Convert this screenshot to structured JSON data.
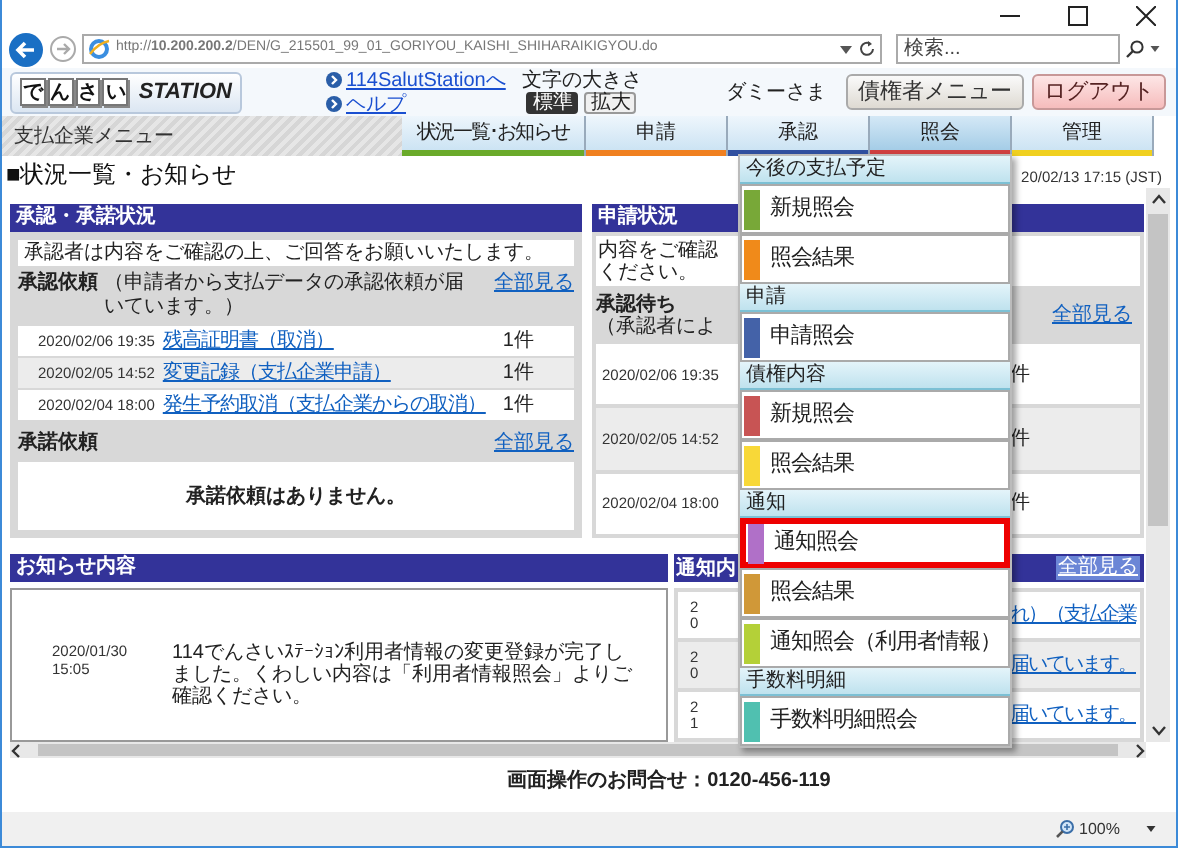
{
  "address_bar": {
    "url": "http://**10.200.200.2**/DEN/G_215501_99_01_GORIYOU_KAISHI_SHIHARAIKIGYOU.do"
  },
  "search": {
    "placeholder": "検索..."
  },
  "header": {
    "logo": {
      "chars": [
        "で",
        "ん",
        "さ",
        "い"
      ],
      "text": "STATION"
    },
    "links": [
      "114SalutStationへ",
      "ヘルプ"
    ],
    "font_size": {
      "label": "文字の大きさ",
      "options": [
        {
          "label": "標準",
          "selected": true
        },
        {
          "label": "拡大",
          "selected": false
        }
      ]
    },
    "user": "ダミーさま",
    "buttons": [
      {
        "label": "債権者メニュー",
        "kind": "default"
      },
      {
        "label": "ログアウト",
        "kind": "danger"
      }
    ]
  },
  "nav": {
    "label": "支払企業メニュー",
    "tabs": [
      {
        "label": "状況一覧･お知らせ",
        "selected": false,
        "color": "#6aaa2a"
      },
      {
        "label": "申請",
        "selected": false,
        "color": "#f08020"
      },
      {
        "label": "承認",
        "selected": false,
        "color": "#3050a0"
      },
      {
        "label": "照会",
        "selected": true,
        "color": "#d04040"
      },
      {
        "label": "管理",
        "selected": false,
        "color": "#f0d020"
      }
    ]
  },
  "page": {
    "title": "■状況一覧・お知らせ",
    "timestamp": "20/02/13 17:15 (JST)"
  },
  "approval_panel": {
    "title": "承認・承諾状況",
    "intro": "承認者は内容をご確認の上、ご回答をお願いいたします。",
    "request_section": {
      "title": "承認依頼",
      "note": "（申請者から支払データの承認依頼が届いています。）",
      "more": "全部見る",
      "rows": [
        {
          "date": "2020/02/06 19:35",
          "link": "残高証明書（取消）",
          "count": "1件"
        },
        {
          "date": "2020/02/05 14:52",
          "link": "変更記録（支払企業申請）",
          "count": "1件"
        },
        {
          "date": "2020/02/04 18:00",
          "link": "発生予約取消（支払企業からの取消）",
          "count": "1件"
        }
      ]
    },
    "consent_section": {
      "title": "承諾依頼",
      "more": "全部見る",
      "empty": "承諾依頼はありません。"
    }
  },
  "application_panel": {
    "title": "申請状況",
    "intro": "内容をご確認ください。",
    "section_title": "承認待ち",
    "note": "（承認者によ",
    "more": "全部見る",
    "rows": [
      {
        "date": "2020/02/06 19:35",
        "count": "件"
      },
      {
        "date": "2020/02/05 14:52",
        "count": "件"
      },
      {
        "date": "2020/02/04 18:00",
        "count": "件"
      }
    ]
  },
  "notice_panel": {
    "title": "お知らせ内容",
    "rows": [
      {
        "date": "2020/01/30",
        "time": "15:05",
        "text": "114でんさいｽﾃｰｼｮﾝ利用者情報の変更登録が完了しました。くわしい内容は「利用者情報照会」よりご確認ください。"
      }
    ]
  },
  "notification_panel": {
    "title": "通知内",
    "more": "全部見る",
    "rows": [
      {
        "date_fragment": [
          "2",
          "0"
        ],
        "text": "れ）（支払企業"
      },
      {
        "date_fragment": [
          "2",
          "0"
        ],
        "text": "届いています。"
      },
      {
        "date_fragment": [
          "2",
          "1"
        ],
        "text": "届いています。"
      }
    ]
  },
  "menu": {
    "sections": [
      {
        "title": "今後の支払予定",
        "items": [
          {
            "label": "新規照会",
            "color": "#78a838",
            "selected": false
          },
          {
            "label": "照会結果",
            "color": "#f08a1a",
            "selected": false
          }
        ]
      },
      {
        "title": "申請",
        "items": [
          {
            "label": "申請照会",
            "color": "#4462a8",
            "selected": false
          }
        ]
      },
      {
        "title": "債権内容",
        "items": [
          {
            "label": "新規照会",
            "color": "#c85454",
            "selected": false
          },
          {
            "label": "照会結果",
            "color": "#f8d838",
            "selected": false
          }
        ]
      },
      {
        "title": "通知",
        "items": [
          {
            "label": "通知照会",
            "color": "#b070c8",
            "selected": true
          },
          {
            "label": "照会結果",
            "color": "#d09838",
            "selected": false
          },
          {
            "label": "通知照会（利用者情報）",
            "color": "#b4d038",
            "selected": false
          }
        ]
      },
      {
        "title": "手数料明細",
        "items": [
          {
            "label": "手数料明細照会",
            "color": "#50c0b0",
            "selected": false
          }
        ]
      }
    ]
  },
  "footer": "画面操作のお問合せ：0120-456-119",
  "status_bar": {
    "zoom": "100%"
  }
}
